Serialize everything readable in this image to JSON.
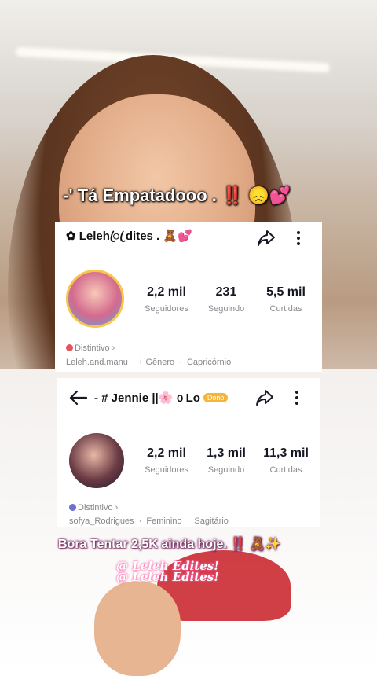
{
  "overlay": {
    "top_caption": "-' Tá Empatadooo . ‼️ 😞💕",
    "bottom_caption": "Bora Tentar 2,5K ainda hoje. ‼️ 🧸✨",
    "credit_1": "@ Leleh Edites!",
    "credit_2": "@ Leleh Edites!"
  },
  "profile1": {
    "username": "✿ Lelehꦿ ꦿdites . 🧸💕",
    "stats": [
      {
        "value": "2,2 mil",
        "label": "Seguidores"
      },
      {
        "value": "231",
        "label": "Seguindo"
      },
      {
        "value": "5,5 mil",
        "label": "Curtidas"
      }
    ],
    "badge": "Distintivo ›",
    "handle": "Leleh.and.manu",
    "gender": "+ Gênero",
    "sign": "Capricórnio",
    "badge_color": "#e2555f"
  },
  "profile2": {
    "username": "- # Jennie ||🌸 ൦ Lo",
    "owner_tag": "Dono",
    "stats": [
      {
        "value": "2,2 mil",
        "label": "Seguidores"
      },
      {
        "value": "1,3 mil",
        "label": "Seguindo"
      },
      {
        "value": "11,3 mil",
        "label": "Curtidas"
      }
    ],
    "badge": "Distintivo ›",
    "handle": "sofya_Rodrigues",
    "gender": "Feminino",
    "sign": "Sagitário",
    "badge_color": "#6b6fd6"
  },
  "icons": {
    "share": "share-icon",
    "more": "more-icon",
    "back": "back-arrow-icon"
  }
}
